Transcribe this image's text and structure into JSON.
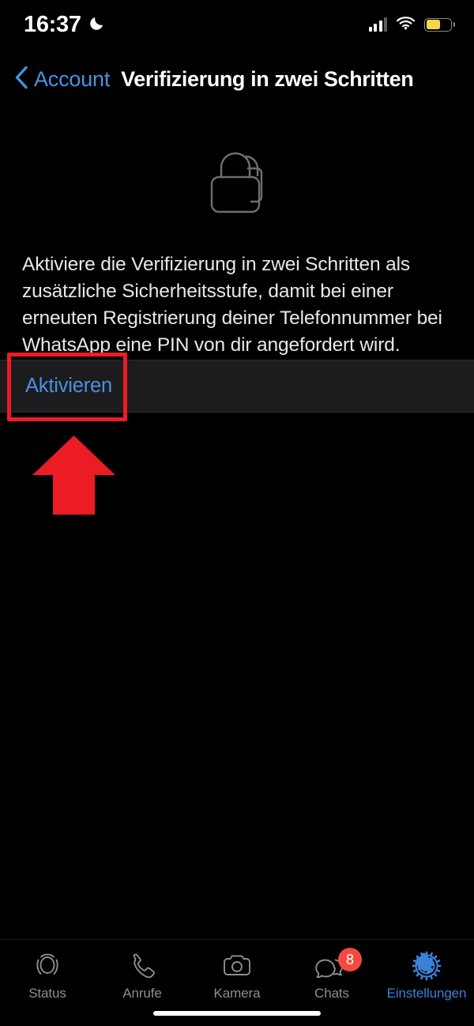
{
  "status_bar": {
    "time": "16:37",
    "dnd_icon": "moon-icon",
    "signal_icon": "cellular-signal-icon",
    "signal_bars": 3,
    "wifi_icon": "wifi-icon",
    "battery_icon": "battery-icon",
    "battery_color": "#f7d64a",
    "battery_level_percent": 60
  },
  "nav_bar": {
    "back_icon": "chevron-left-icon",
    "back_label": "Account",
    "title": "Verifizierung in zwei Schritten",
    "accent_color": "#4a90e2"
  },
  "hero": {
    "icon": "two-locks-icon",
    "stroke_color": "#6e6e73"
  },
  "main": {
    "description": "Aktiviere die Verifizierung in zwei Schritten als zusätzliche Sicherheitsstufe, damit bei einer erneuten Registrierung deiner Telefonnummer bei WhatsApp eine PIN von dir angefordert wird.",
    "action_label": "Aktivieren",
    "action_color": "#4a90e2",
    "row_background": "#1c1c1e"
  },
  "annotation": {
    "highlight_color": "#ec1c24",
    "highlight_target": "Aktivieren",
    "arrow_icon": "arrow-up-icon"
  },
  "tab_bar": {
    "items": [
      {
        "label": "Status",
        "icon": "status-rings-icon",
        "active": false,
        "badge": ""
      },
      {
        "label": "Anrufe",
        "icon": "phone-icon",
        "active": false,
        "badge": ""
      },
      {
        "label": "Kamera",
        "icon": "camera-icon",
        "active": false,
        "badge": ""
      },
      {
        "label": "Chats",
        "icon": "chat-bubbles-icon",
        "active": false,
        "badge": "8"
      },
      {
        "label": "Einstellungen",
        "icon": "gear-icon",
        "active": true,
        "badge": ""
      }
    ],
    "inactive_color": "#8e8e93",
    "active_color": "#3b82d6",
    "badge_color": "#f24b3e"
  },
  "home_indicator": {
    "icon": "home-indicator"
  }
}
